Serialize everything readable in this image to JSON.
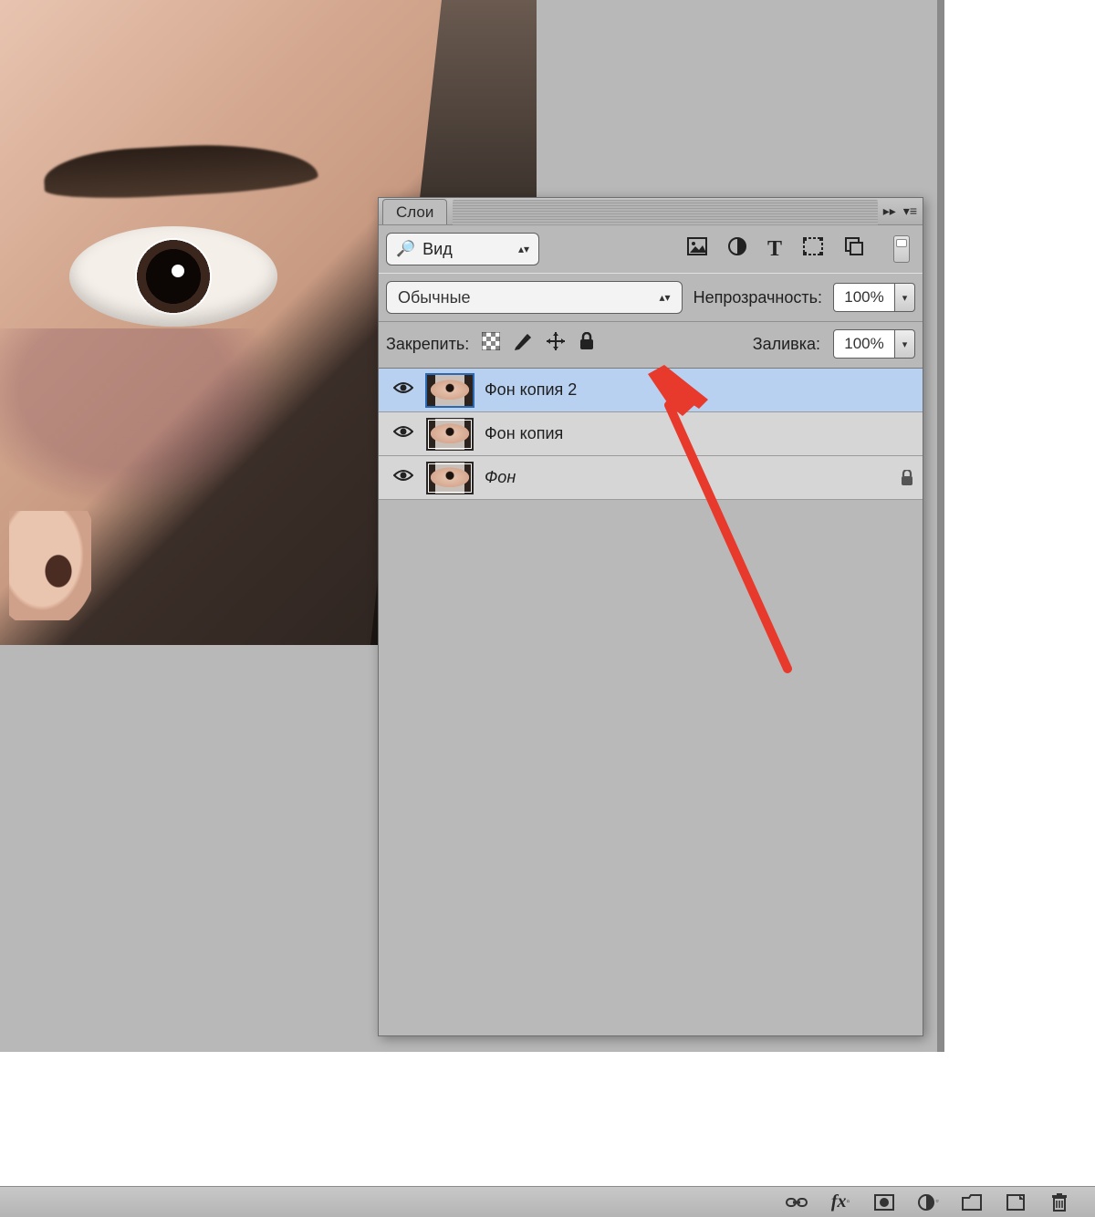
{
  "panel": {
    "tab_label": "Слои",
    "search_label": "Вид",
    "blend_mode": "Обычные",
    "opacity_label": "Непрозрачность:",
    "opacity_value": "100%",
    "lock_label": "Закрепить:",
    "fill_label": "Заливка:",
    "fill_value": "100%"
  },
  "filter_icons": [
    "image-filter",
    "adjustment-filter",
    "type-filter",
    "shape-filter",
    "smartobject-filter"
  ],
  "layers": [
    {
      "visible": true,
      "name": "Фон копия 2",
      "selected": true,
      "locked": false,
      "italic": false
    },
    {
      "visible": true,
      "name": "Фон копия",
      "selected": false,
      "locked": false,
      "italic": false
    },
    {
      "visible": true,
      "name": "Фон",
      "selected": false,
      "locked": true,
      "italic": true
    }
  ],
  "bottombar_icons": [
    "link-layers",
    "fx",
    "layer-mask",
    "adjustment-layer",
    "group",
    "new-layer",
    "delete-layer"
  ],
  "annotation": {
    "color": "#e83a2c"
  }
}
